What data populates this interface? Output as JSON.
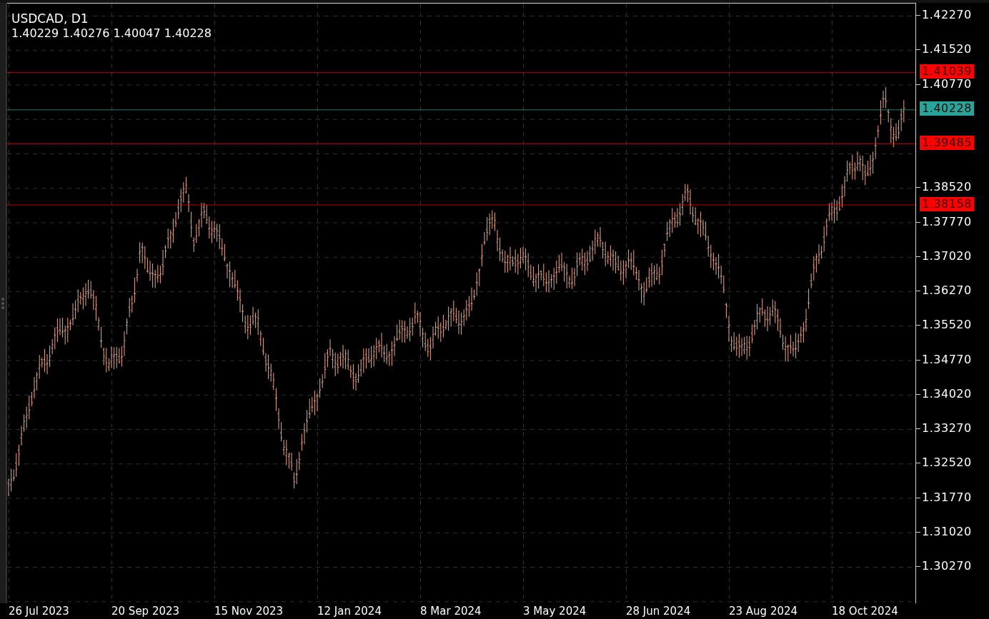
{
  "symbol": {
    "title": "USDCAD, D1",
    "ohlc": "1.40229 1.40276 1.40047 1.40228"
  },
  "price_axis": {
    "labels": [
      "1.42270",
      "1.41520",
      "1.40770",
      "1.38520",
      "1.37770",
      "1.37020",
      "1.36270",
      "1.35520",
      "1.34770",
      "1.34020",
      "1.33270",
      "1.32520",
      "1.31770",
      "1.31020",
      "1.30270"
    ]
  },
  "price_lines": [
    {
      "price": "1.41039",
      "color": "#ff0000"
    },
    {
      "price": "1.40228",
      "color": "#26a69a"
    },
    {
      "price": "1.39485",
      "color": "#ff0000"
    },
    {
      "price": "1.38158",
      "color": "#ff0000"
    }
  ],
  "time_axis": {
    "labels": [
      "26 Jul 2023",
      "20 Sep 2023",
      "15 Nov 2023",
      "12 Jan 2024",
      "8 Mar 2024",
      "3 May 2024",
      "28 Jun 2024",
      "23 Aug 2024",
      "18 Oct 2024"
    ]
  }
}
